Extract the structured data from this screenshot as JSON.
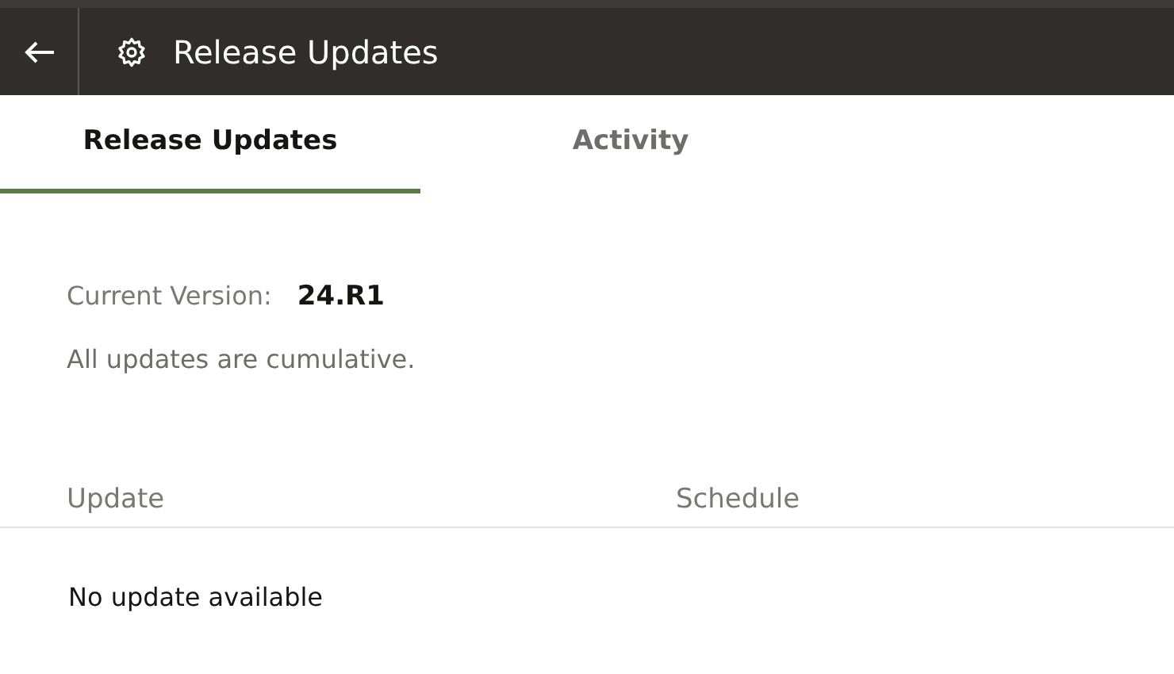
{
  "header": {
    "title": "Release Updates"
  },
  "tabs": [
    {
      "label": "Release Updates",
      "selected": true
    },
    {
      "label": "Activity",
      "selected": false
    }
  ],
  "version": {
    "label": "Current Version:",
    "value": "24.R1",
    "note": "All updates are cumulative."
  },
  "table": {
    "columns": [
      "Update",
      "Schedule"
    ],
    "empty_message": "No update available"
  }
}
